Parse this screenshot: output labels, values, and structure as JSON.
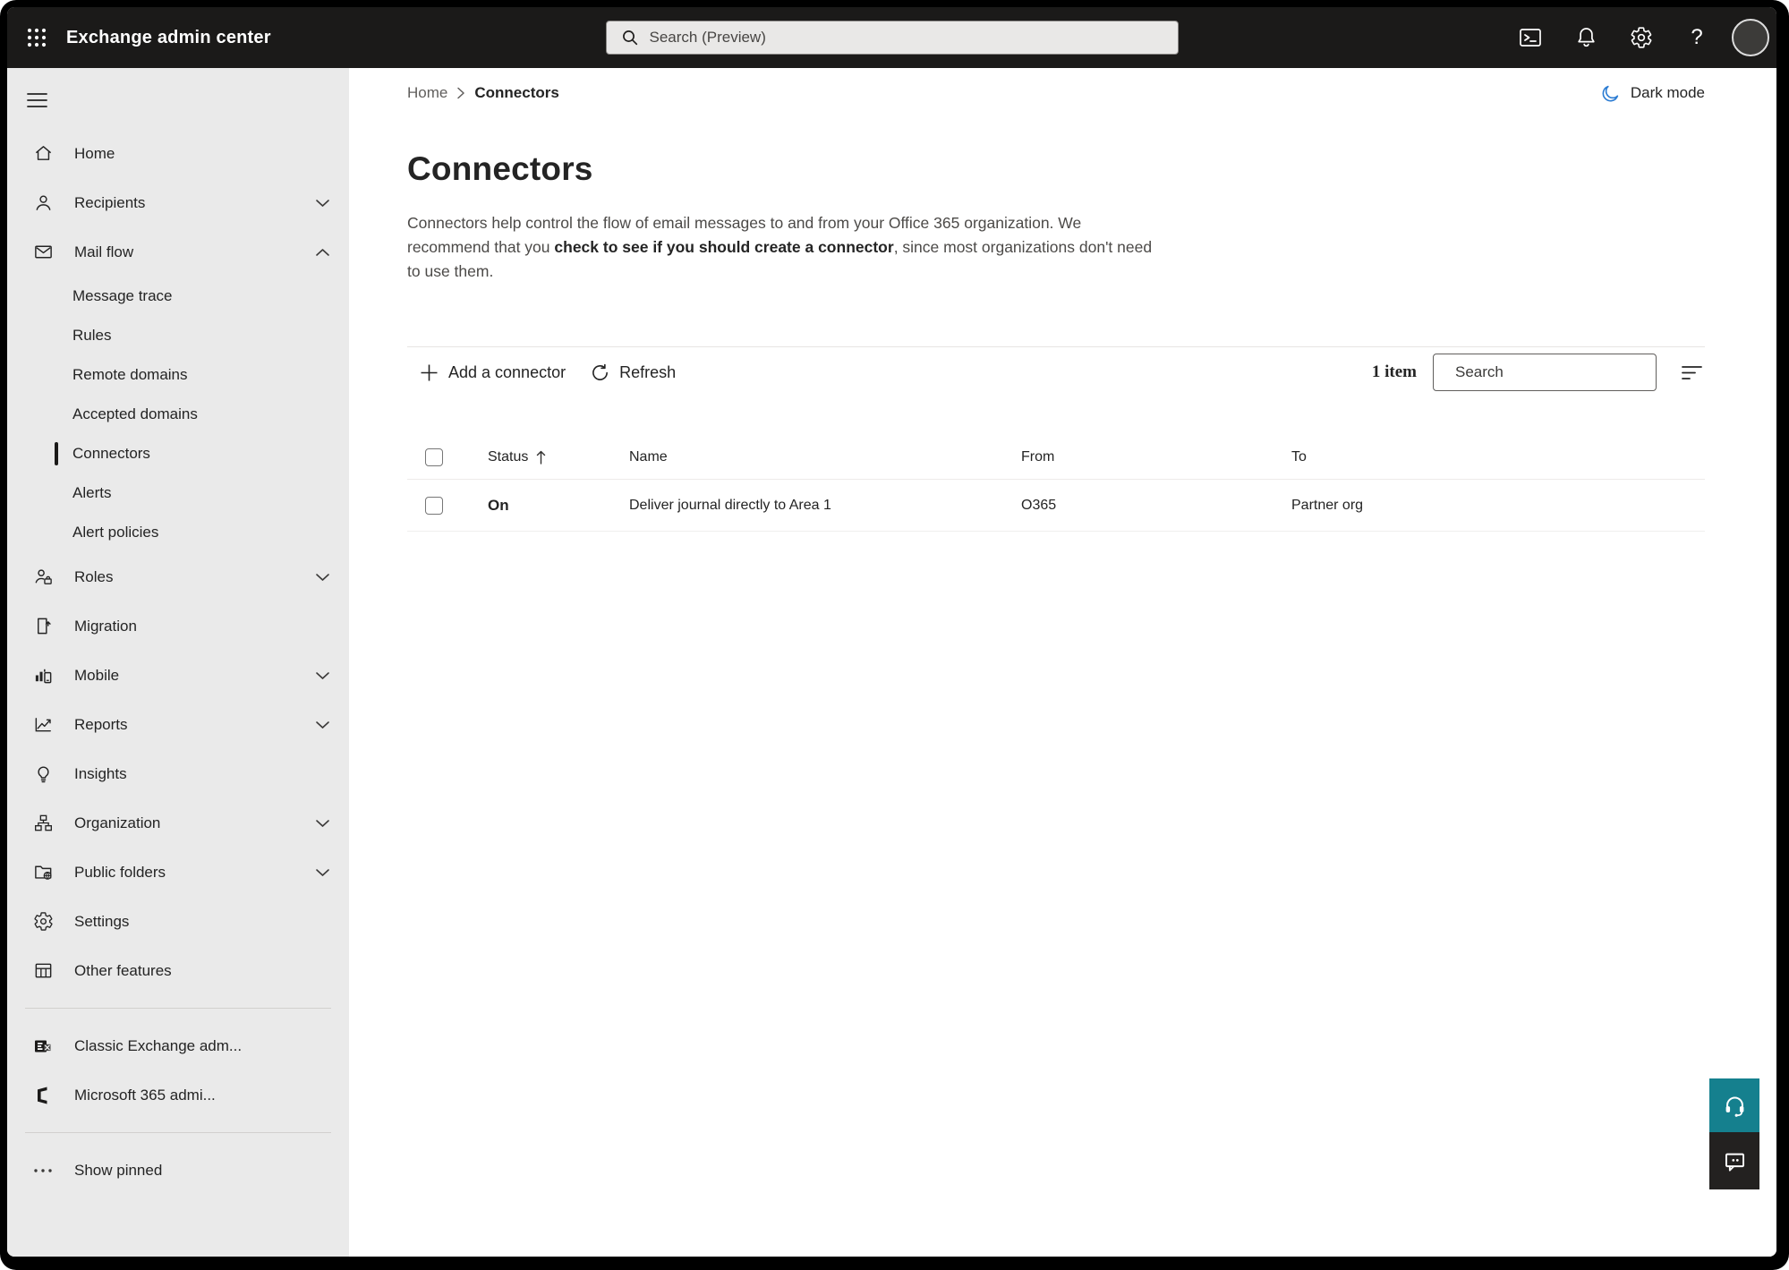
{
  "topbar": {
    "app_title": "Exchange admin center",
    "search_placeholder": "Search (Preview)",
    "help_glyph": "?"
  },
  "sidebar": {
    "items": [
      {
        "label": "Home"
      },
      {
        "label": "Recipients"
      },
      {
        "label": "Mail flow"
      },
      {
        "label": "Message trace"
      },
      {
        "label": "Rules"
      },
      {
        "label": "Remote domains"
      },
      {
        "label": "Accepted domains"
      },
      {
        "label": "Connectors",
        "selected": true
      },
      {
        "label": "Alerts"
      },
      {
        "label": "Alert policies"
      },
      {
        "label": "Roles"
      },
      {
        "label": "Migration"
      },
      {
        "label": "Mobile"
      },
      {
        "label": "Reports"
      },
      {
        "label": "Insights"
      },
      {
        "label": "Organization"
      },
      {
        "label": "Public folders"
      },
      {
        "label": "Settings"
      },
      {
        "label": "Other features"
      }
    ],
    "external_links": [
      {
        "label": "Classic Exchange adm..."
      },
      {
        "label": "Microsoft 365 admi..."
      }
    ],
    "show_pinned_label": "Show pinned"
  },
  "main": {
    "breadcrumb": {
      "home": "Home",
      "current": "Connectors"
    },
    "dark_mode_label": "Dark mode",
    "page_title": "Connectors",
    "description": {
      "pre": "Connectors help control the flow of email messages to and from your Office 365 organization. We recommend that you ",
      "emphasis": "check to see if you should create a connector",
      "post": ", since most organizations don't need to use them."
    },
    "toolbar": {
      "add_connector_label": "Add a connector",
      "refresh_label": "Refresh",
      "item_count": "1 item",
      "search_placeholder": "Search"
    },
    "table": {
      "columns": {
        "status": "Status",
        "name": "Name",
        "from": "From",
        "to": "To"
      },
      "rows": [
        {
          "status": "On",
          "name": "Deliver journal directly to Area 1",
          "from": "O365",
          "to": "Partner org"
        }
      ]
    }
  },
  "colors": {
    "topbar_bg": "#1b1a19",
    "sidebar_bg": "#eaeaea",
    "help_button_teal": "#15808e",
    "feedback_button_dark": "#232120",
    "dark_mode_moon_blue": "#2b7cd3",
    "selected_indicator": "#1b1a19"
  }
}
